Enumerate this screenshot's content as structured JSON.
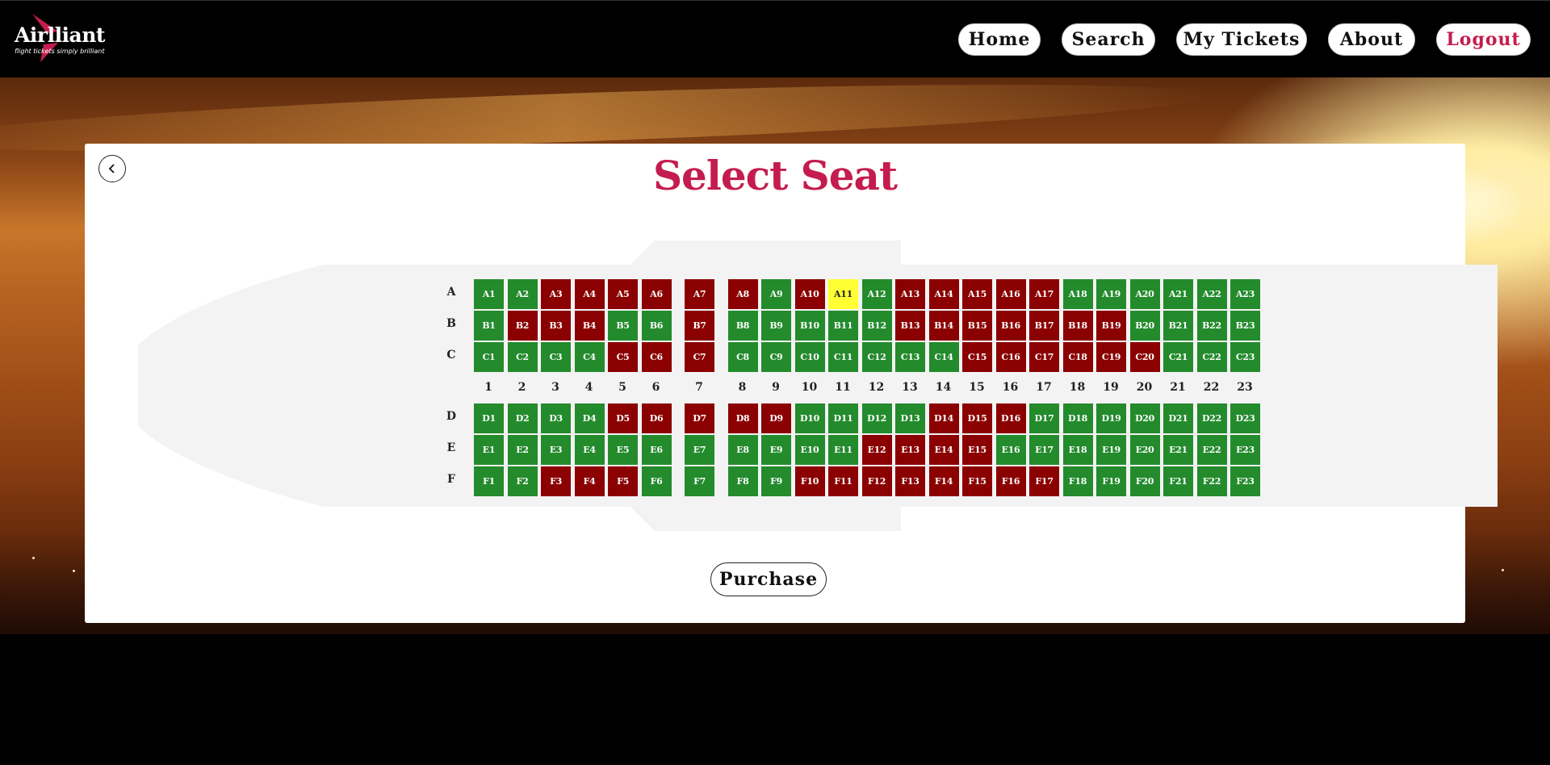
{
  "brand": {
    "name": "Airlliant",
    "tagline": "flight tickets simply brilliant",
    "color": "#c41c4e"
  },
  "nav": [
    {
      "key": "home",
      "label": "Home",
      "color": "#111111"
    },
    {
      "key": "search",
      "label": "Search",
      "color": "#111111"
    },
    {
      "key": "my-tickets",
      "label": "My Tickets",
      "color": "#111111"
    },
    {
      "key": "about",
      "label": "About",
      "color": "#111111"
    },
    {
      "key": "logout",
      "label": "Logout",
      "color": "#c41c4e"
    }
  ],
  "page": {
    "title": "Select Seat",
    "back_icon": "chevron-left-icon",
    "purchase_label": "Purchase"
  },
  "seat_colors": {
    "available": "#238b2c",
    "taken": "#8b0000",
    "selected": "#ffff33"
  },
  "seat_map": {
    "top_rows": [
      "A",
      "B",
      "C"
    ],
    "bottom_rows": [
      "D",
      "E",
      "F"
    ],
    "columns": [
      "1",
      "2",
      "3",
      "4",
      "5",
      "6",
      "7",
      "8",
      "9",
      "10",
      "11",
      "12",
      "13",
      "14",
      "15",
      "16",
      "17",
      "18",
      "19",
      "20",
      "21",
      "22",
      "23"
    ],
    "rows": [
      {
        "row": "A",
        "seats": [
          {
            "label": "A1",
            "status": "available"
          },
          {
            "label": "A2",
            "status": "available"
          },
          {
            "label": "A3",
            "status": "taken"
          },
          {
            "label": "A4",
            "status": "taken"
          },
          {
            "label": "A5",
            "status": "taken"
          },
          {
            "label": "A6",
            "status": "taken"
          },
          {
            "label": "A7",
            "status": "taken"
          },
          {
            "label": "A8",
            "status": "taken"
          },
          {
            "label": "A9",
            "status": "available"
          },
          {
            "label": "A10",
            "status": "taken"
          },
          {
            "label": "A11",
            "status": "selected"
          },
          {
            "label": "A12",
            "status": "available"
          },
          {
            "label": "A13",
            "status": "taken"
          },
          {
            "label": "A14",
            "status": "taken"
          },
          {
            "label": "A15",
            "status": "taken"
          },
          {
            "label": "A16",
            "status": "taken"
          },
          {
            "label": "A17",
            "status": "taken"
          },
          {
            "label": "A18",
            "status": "available"
          },
          {
            "label": "A19",
            "status": "available"
          },
          {
            "label": "A20",
            "status": "available"
          },
          {
            "label": "A21",
            "status": "available"
          },
          {
            "label": "A22",
            "status": "available"
          },
          {
            "label": "A23",
            "status": "available"
          }
        ]
      },
      {
        "row": "B",
        "seats": [
          {
            "label": "B1",
            "status": "available"
          },
          {
            "label": "B2",
            "status": "taken"
          },
          {
            "label": "B3",
            "status": "taken"
          },
          {
            "label": "B4",
            "status": "taken"
          },
          {
            "label": "B5",
            "status": "available"
          },
          {
            "label": "B6",
            "status": "available"
          },
          {
            "label": "B7",
            "status": "taken"
          },
          {
            "label": "B8",
            "status": "available"
          },
          {
            "label": "B9",
            "status": "available"
          },
          {
            "label": "B10",
            "status": "available"
          },
          {
            "label": "B11",
            "status": "available"
          },
          {
            "label": "B12",
            "status": "available"
          },
          {
            "label": "B13",
            "status": "taken"
          },
          {
            "label": "B14",
            "status": "taken"
          },
          {
            "label": "B15",
            "status": "taken"
          },
          {
            "label": "B16",
            "status": "taken"
          },
          {
            "label": "B17",
            "status": "taken"
          },
          {
            "label": "B18",
            "status": "taken"
          },
          {
            "label": "B19",
            "status": "taken"
          },
          {
            "label": "B20",
            "status": "available"
          },
          {
            "label": "B21",
            "status": "available"
          },
          {
            "label": "B22",
            "status": "available"
          },
          {
            "label": "B23",
            "status": "available"
          }
        ]
      },
      {
        "row": "C",
        "seats": [
          {
            "label": "C1",
            "status": "available"
          },
          {
            "label": "C2",
            "status": "available"
          },
          {
            "label": "C3",
            "status": "available"
          },
          {
            "label": "C4",
            "status": "available"
          },
          {
            "label": "C5",
            "status": "taken"
          },
          {
            "label": "C6",
            "status": "taken"
          },
          {
            "label": "C7",
            "status": "taken"
          },
          {
            "label": "C8",
            "status": "available"
          },
          {
            "label": "C9",
            "status": "available"
          },
          {
            "label": "C10",
            "status": "available"
          },
          {
            "label": "C11",
            "status": "available"
          },
          {
            "label": "C12",
            "status": "available"
          },
          {
            "label": "C13",
            "status": "available"
          },
          {
            "label": "C14",
            "status": "available"
          },
          {
            "label": "C15",
            "status": "taken"
          },
          {
            "label": "C16",
            "status": "taken"
          },
          {
            "label": "C17",
            "status": "taken"
          },
          {
            "label": "C18",
            "status": "taken"
          },
          {
            "label": "C19",
            "status": "taken"
          },
          {
            "label": "C20",
            "status": "taken"
          },
          {
            "label": "C21",
            "status": "available"
          },
          {
            "label": "C22",
            "status": "available"
          },
          {
            "label": "C23",
            "status": "available"
          }
        ]
      },
      {
        "row": "D",
        "seats": [
          {
            "label": "D1",
            "status": "available"
          },
          {
            "label": "D2",
            "status": "available"
          },
          {
            "label": "D3",
            "status": "available"
          },
          {
            "label": "D4",
            "status": "available"
          },
          {
            "label": "D5",
            "status": "taken"
          },
          {
            "label": "D6",
            "status": "taken"
          },
          {
            "label": "D7",
            "status": "taken"
          },
          {
            "label": "D8",
            "status": "taken"
          },
          {
            "label": "D9",
            "status": "taken"
          },
          {
            "label": "D10",
            "status": "available"
          },
          {
            "label": "D11",
            "status": "available"
          },
          {
            "label": "D12",
            "status": "available"
          },
          {
            "label": "D13",
            "status": "available"
          },
          {
            "label": "D14",
            "status": "taken"
          },
          {
            "label": "D15",
            "status": "taken"
          },
          {
            "label": "D16",
            "status": "taken"
          },
          {
            "label": "D17",
            "status": "available"
          },
          {
            "label": "D18",
            "status": "available"
          },
          {
            "label": "D19",
            "status": "available"
          },
          {
            "label": "D20",
            "status": "available"
          },
          {
            "label": "D21",
            "status": "available"
          },
          {
            "label": "D22",
            "status": "available"
          },
          {
            "label": "D23",
            "status": "available"
          }
        ]
      },
      {
        "row": "E",
        "seats": [
          {
            "label": "E1",
            "status": "available"
          },
          {
            "label": "E2",
            "status": "available"
          },
          {
            "label": "E3",
            "status": "available"
          },
          {
            "label": "E4",
            "status": "available"
          },
          {
            "label": "E5",
            "status": "available"
          },
          {
            "label": "E6",
            "status": "available"
          },
          {
            "label": "E7",
            "status": "available"
          },
          {
            "label": "E8",
            "status": "available"
          },
          {
            "label": "E9",
            "status": "available"
          },
          {
            "label": "E10",
            "status": "available"
          },
          {
            "label": "E11",
            "status": "available"
          },
          {
            "label": "E12",
            "status": "taken"
          },
          {
            "label": "E13",
            "status": "taken"
          },
          {
            "label": "E14",
            "status": "taken"
          },
          {
            "label": "E15",
            "status": "taken"
          },
          {
            "label": "E16",
            "status": "available"
          },
          {
            "label": "E17",
            "status": "available"
          },
          {
            "label": "E18",
            "status": "available"
          },
          {
            "label": "E19",
            "status": "available"
          },
          {
            "label": "E20",
            "status": "available"
          },
          {
            "label": "E21",
            "status": "available"
          },
          {
            "label": "E22",
            "status": "available"
          },
          {
            "label": "E23",
            "status": "available"
          }
        ]
      },
      {
        "row": "F",
        "seats": [
          {
            "label": "F1",
            "status": "available"
          },
          {
            "label": "F2",
            "status": "available"
          },
          {
            "label": "F3",
            "status": "taken"
          },
          {
            "label": "F4",
            "status": "taken"
          },
          {
            "label": "F5",
            "status": "taken"
          },
          {
            "label": "F6",
            "status": "available"
          },
          {
            "label": "F7",
            "status": "available"
          },
          {
            "label": "F8",
            "status": "available"
          },
          {
            "label": "F9",
            "status": "available"
          },
          {
            "label": "F10",
            "status": "taken"
          },
          {
            "label": "F11",
            "status": "taken"
          },
          {
            "label": "F12",
            "status": "taken"
          },
          {
            "label": "F13",
            "status": "taken"
          },
          {
            "label": "F14",
            "status": "taken"
          },
          {
            "label": "F15",
            "status": "taken"
          },
          {
            "label": "F16",
            "status": "taken"
          },
          {
            "label": "F17",
            "status": "taken"
          },
          {
            "label": "F18",
            "status": "available"
          },
          {
            "label": "F19",
            "status": "available"
          },
          {
            "label": "F20",
            "status": "available"
          },
          {
            "label": "F21",
            "status": "available"
          },
          {
            "label": "F22",
            "status": "available"
          },
          {
            "label": "F23",
            "status": "available"
          }
        ]
      }
    ]
  }
}
